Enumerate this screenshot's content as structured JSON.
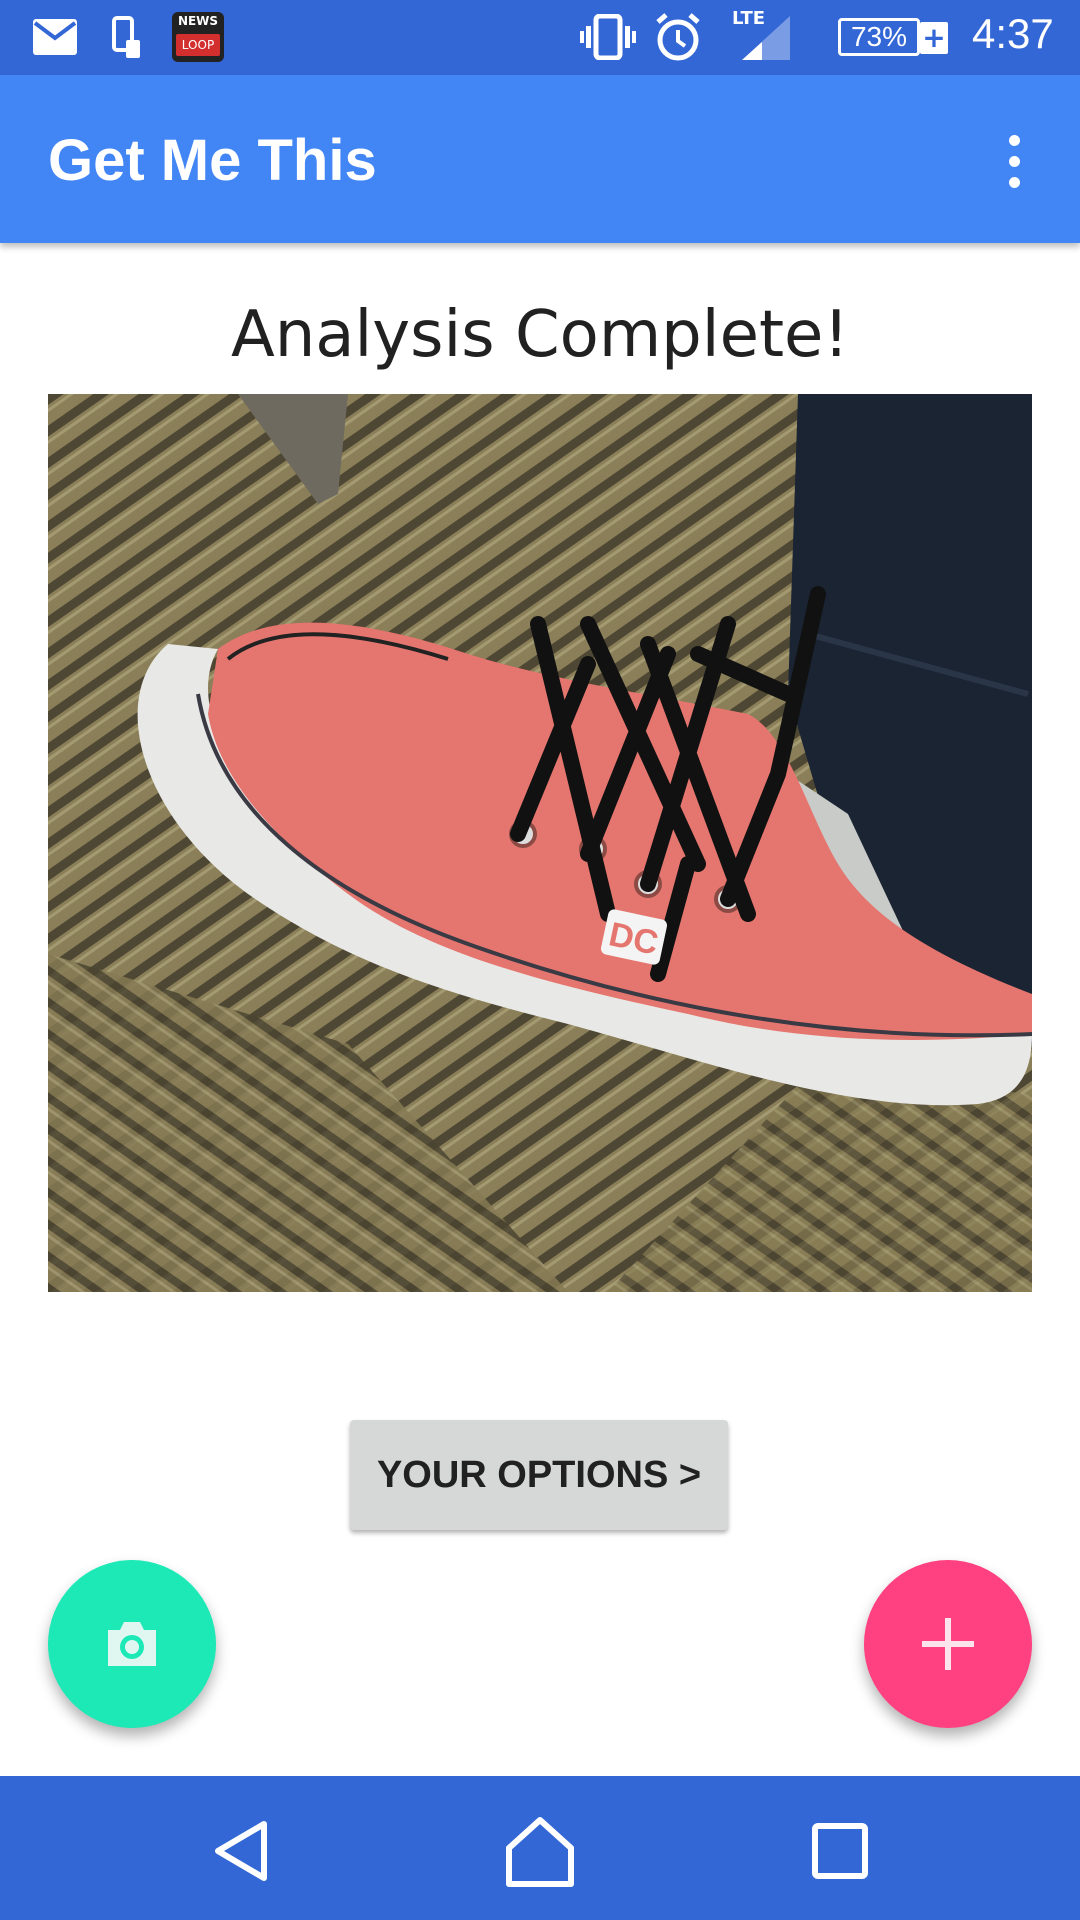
{
  "status_bar": {
    "icons": [
      "mail-icon",
      "phone-sync-icon",
      "news-loop-icon",
      "vibrate-icon",
      "alarm-icon",
      "signal-icon",
      "battery-icon"
    ],
    "news_badge": {
      "top": "NEWS",
      "bottom": "LOOP"
    },
    "network": "LTE",
    "battery": "73%",
    "charging_symbol": "+",
    "time": "4:37"
  },
  "app_bar": {
    "title": "Get Me This",
    "menu_icon": "more-vert-icon"
  },
  "main": {
    "headline": "Analysis Complete!",
    "photo_subject": "shoe-photo",
    "photo_brand_mark": "DC",
    "options_button": "YOUR OPTIONS >"
  },
  "fabs": {
    "camera_icon": "camera-icon",
    "add_icon": "plus-icon"
  },
  "nav_bar": {
    "icons": [
      "back-icon",
      "home-icon",
      "recents-icon"
    ]
  },
  "colors": {
    "status_bar": "#3367d6",
    "app_bar": "#4285f4",
    "camera_fab": "#1de9b6",
    "add_fab": "#ff4081",
    "button_bg": "#d6d7d7"
  }
}
